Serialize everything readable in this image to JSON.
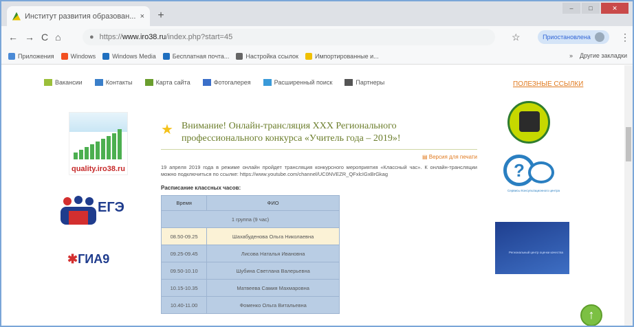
{
  "browser": {
    "tab_title": "Институт развития образован...",
    "tab_close": "×",
    "new_tab": "+",
    "nav": {
      "back": "←",
      "forward": "→",
      "reload": "C",
      "home": "⌂"
    },
    "url_prefix": "https://",
    "url_host": "www.iro38.ru",
    "url_path": "/index.php?start=45",
    "profile_label": "Приостановлена",
    "menu": "⋮"
  },
  "bookmarks": [
    {
      "label": "Приложения",
      "color": "#4a8ad6"
    },
    {
      "label": "Windows",
      "color": "#f25022"
    },
    {
      "label": "Windows Media",
      "color": "#1f6fbf"
    },
    {
      "label": "Бесплатная почта...",
      "color": "#1f6fbf"
    },
    {
      "label": "Настройка ссылок",
      "color": "#666"
    },
    {
      "label": "Импортированные и...",
      "color": "#f0c000"
    }
  ],
  "bookmarks_right": "Другие закладки",
  "site_nav": [
    {
      "label": "Вакансии",
      "color": "#9bbf3a"
    },
    {
      "label": "Контакты",
      "color": "#3a7fc9"
    },
    {
      "label": "Карта сайта",
      "color": "#6a9e2e"
    },
    {
      "label": "Фотогалерея",
      "color": "#3a6fc9"
    },
    {
      "label": "Расширенный поиск",
      "color": "#3a9ad9"
    },
    {
      "label": "Партнеры",
      "color": "#555"
    }
  ],
  "useful_links": "ПОЛЕЗНЫЕ ССЫЛКИ",
  "left": {
    "quality_label": "quality.iro38.ru",
    "ege_label": "ЕГЭ",
    "gia_label": "ГИА9"
  },
  "announcement": {
    "title": "Внимание! Онлайн-трансляция XXX Регионального профессионального конкурса «Учитель года – 2019»!",
    "print_label": "Версия для печати",
    "body": "19 апреля 2019 года в режиме онлайн пройдет трансляция конкурсного мероприятия «Классный час». К онлайн-трансляции можно подключиться по ссылке: https://www.youtube.com/channel/UC0NVEZR_QFxlcIGxBrGkag",
    "schedule_title": "Расписание классных часов:",
    "table": {
      "headers": [
        "Время",
        "ФИО"
      ],
      "group": "1 группа (9 час)",
      "rows": [
        {
          "time": "08.50-09.25",
          "name": "Шахабуденова Ольга Николаевна"
        },
        {
          "time": "09.25-09.45",
          "name": "Лисова Наталья Ивановна"
        },
        {
          "time": "09.50-10.10",
          "name": "Шубина Светлана Валерьевна"
        },
        {
          "time": "10.15-10.35",
          "name": "Матвеева Самия Махмаровна"
        },
        {
          "time": "10.40-11.00",
          "name": "Фоменко Ольга Витальевна"
        }
      ]
    }
  },
  "right": {
    "consult_label": "Сервисы Консультационного центра",
    "banner_label": "Региональный центр оценки качества"
  },
  "scroll_top": "↑"
}
